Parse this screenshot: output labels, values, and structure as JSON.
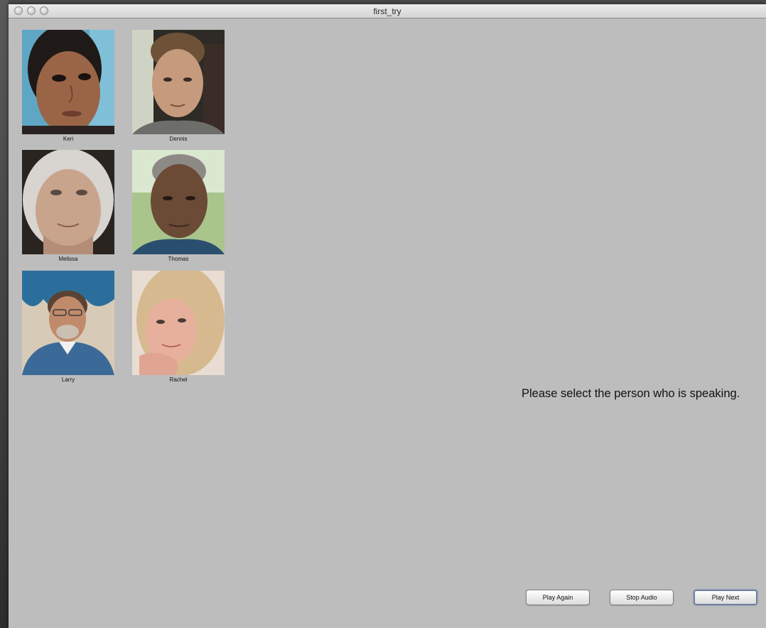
{
  "window": {
    "title": "first_try"
  },
  "people": [
    {
      "name": "Keri"
    },
    {
      "name": "Dennis"
    },
    {
      "name": "Melissa"
    },
    {
      "name": "Thomas"
    },
    {
      "name": "Larry"
    },
    {
      "name": "Rachel"
    }
  ],
  "instruction": "Please select the person who is speaking.",
  "buttons": {
    "play_again": "Play Again",
    "stop_audio": "Stop Audio",
    "play_next": "Play Next"
  }
}
